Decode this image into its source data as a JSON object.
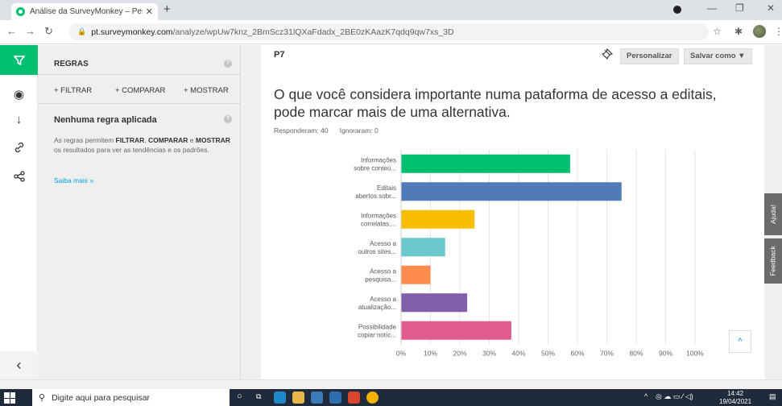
{
  "browser": {
    "tab_title": "Análise da SurveyMonkey – Pesqu",
    "tab_close": "✕",
    "new_tab": "+",
    "url_host": "pt.surveymonkey.com",
    "url_path": "/analyze/wpUw7knz_2BmScz31lQXaFdadx_2BE0zKAazK7qdq9qw7xs_3D"
  },
  "rules_panel": {
    "title": "REGRAS",
    "actions": [
      "+ FILTRAR",
      "+ COMPARAR",
      "+ MOSTRAR"
    ],
    "no_rule": "Nenhuma regra aplicada",
    "desc_1": "As regras permitem ",
    "desc_b1": "FILTRAR",
    "desc_2": ", ",
    "desc_b2": "COMPARAR",
    "desc_3": " e ",
    "desc_b3": "MOSTRAR",
    "desc_4": " os resultados para ver as tendências e os padrões.",
    "learn_more": "Saiba mais »"
  },
  "question": {
    "number": "P7",
    "customize": "Personalizar",
    "save_as": "Salvar como ▼",
    "title": "O que você considera importante numa pataforma de acesso a editais, pode marcar mais de uma alternativa.",
    "answered": "Responderam: 40",
    "skipped": "Ignoraram: 0"
  },
  "side_tabs": {
    "help": "Ajuda!",
    "feedback": "Feedback"
  },
  "taskbar": {
    "search_placeholder": "Digite aqui para pesquisar",
    "time": "14:42",
    "date": "19/04/2021"
  },
  "chart_data": {
    "type": "bar",
    "orientation": "horizontal",
    "categories": [
      [
        "Informações",
        "sobre conteú..."
      ],
      [
        "Editais",
        "abertos sobr..."
      ],
      [
        "Informações",
        "correlatas,..."
      ],
      [
        "Acesso a",
        "outros sites..."
      ],
      [
        "Acesso a",
        "pesquisa..."
      ],
      [
        "Acesso a",
        "atualização..."
      ],
      [
        "Possibilidade",
        "copiar notíc..."
      ]
    ],
    "values": [
      57.5,
      75,
      25,
      15,
      10,
      22.5,
      37.5
    ],
    "colors": [
      "#00bf6f",
      "#507cb6",
      "#f9be00",
      "#6bc8cd",
      "#ff8b4f",
      "#7f5fa9",
      "#e05c8e"
    ],
    "xlim": [
      0,
      100
    ],
    "xticks": [
      "0%",
      "10%",
      "20%",
      "30%",
      "40%",
      "50%",
      "60%",
      "70%",
      "80%",
      "90%",
      "100%"
    ],
    "grid": true
  }
}
